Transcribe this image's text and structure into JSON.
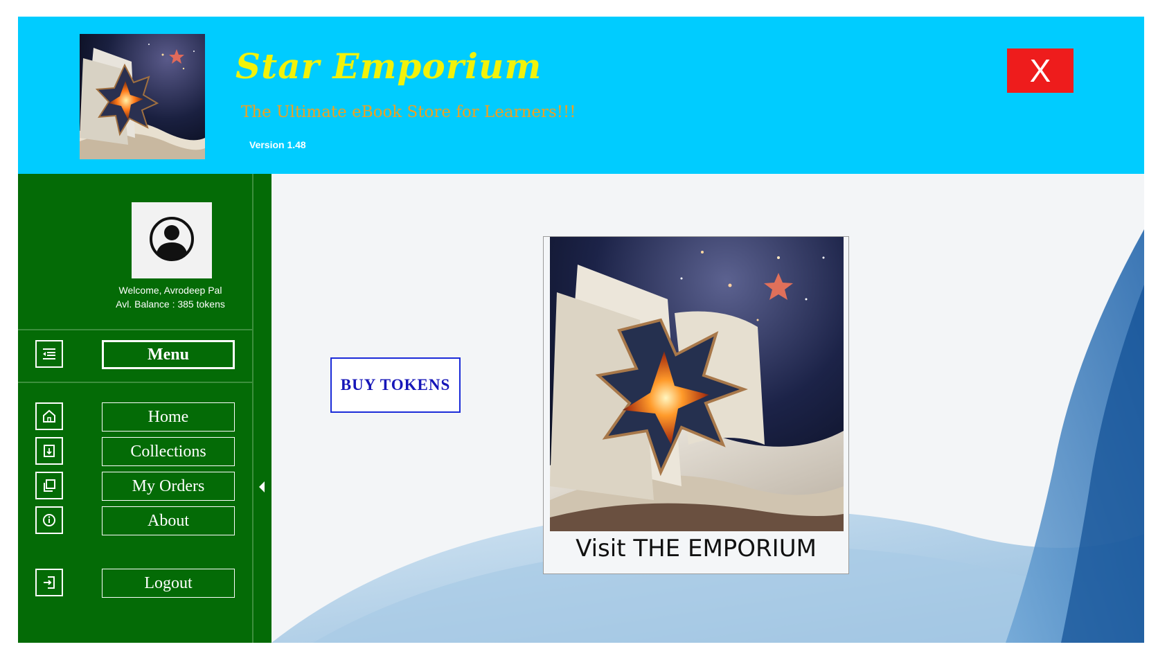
{
  "header": {
    "title": "Star Emporium",
    "subtitle": "The Ultimate eBook Store for Learners!!!",
    "version": "Version 1.48",
    "close_label": "X",
    "logo_icon": "book-star-logo-icon",
    "colors": {
      "header_bg": "#00ccff",
      "title": "#f2f20a",
      "subtitle": "#f0a020",
      "close_bg": "#ee1c1c"
    }
  },
  "sidebar": {
    "user": {
      "welcome": "Welcome, Avrodeep Pal",
      "balance": "Avl. Balance : 385 tokens",
      "avatar_icon": "user-avatar-icon"
    },
    "menu_label": "Menu",
    "items": [
      {
        "label": "Home",
        "icon": "home-icon"
      },
      {
        "label": "Collections",
        "icon": "collections-icon"
      },
      {
        "label": "My Orders",
        "icon": "orders-icon"
      },
      {
        "label": "About",
        "icon": "info-icon"
      }
    ],
    "logout_label": "Logout",
    "colors": {
      "bg": "#046b06"
    }
  },
  "main": {
    "buy_tokens_label": "BUY TOKENS",
    "emporium_label": "Visit THE EMPORIUM"
  }
}
